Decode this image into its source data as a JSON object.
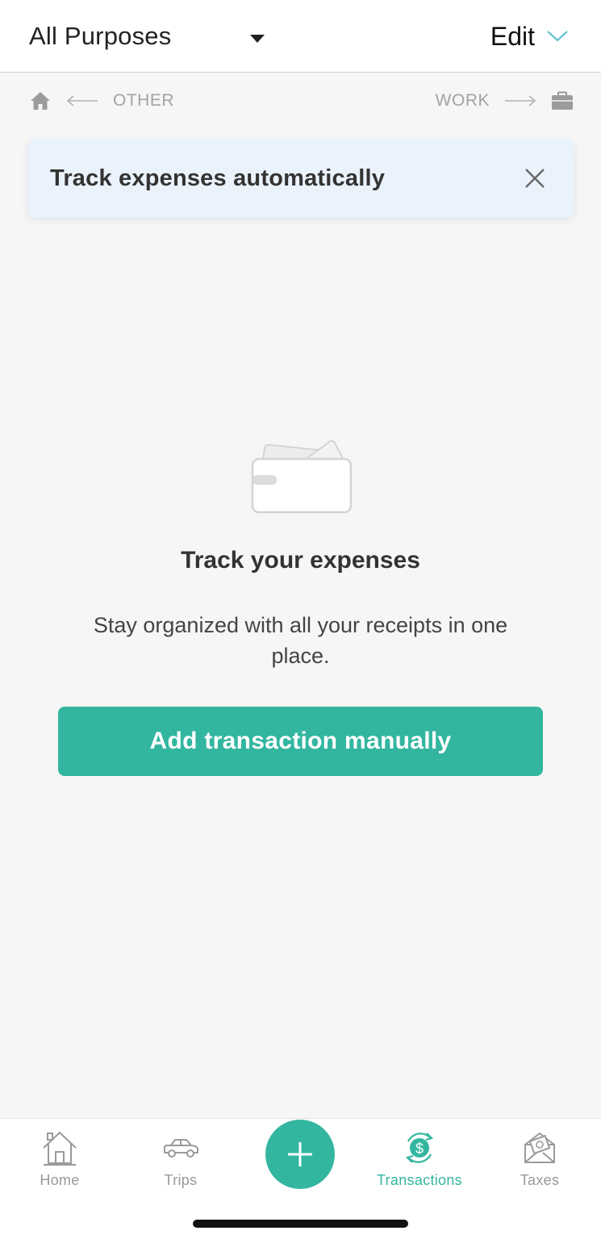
{
  "header": {
    "purpose_label": "All Purposes",
    "edit_label": "Edit"
  },
  "swipe": {
    "left_label": "OTHER",
    "right_label": "WORK"
  },
  "banner": {
    "text": "Track expenses automatically"
  },
  "empty_state": {
    "title": "Track your expenses",
    "description": "Stay organized with all your receipts in one place.",
    "button_label": "Add transaction manually"
  },
  "bottom_nav": {
    "items": [
      {
        "label": "Home",
        "icon": "home-icon",
        "active": false
      },
      {
        "label": "Trips",
        "icon": "car-icon",
        "active": false
      },
      {
        "label": "Transactions",
        "icon": "transactions-icon",
        "active": true
      },
      {
        "label": "Taxes",
        "icon": "taxes-envelope-icon",
        "active": false
      }
    ]
  },
  "colors": {
    "accent": "#33b6a0",
    "background": "#f6f6f6",
    "banner_bg": "#eaf2fb",
    "muted_text": "#a3a3a3"
  }
}
